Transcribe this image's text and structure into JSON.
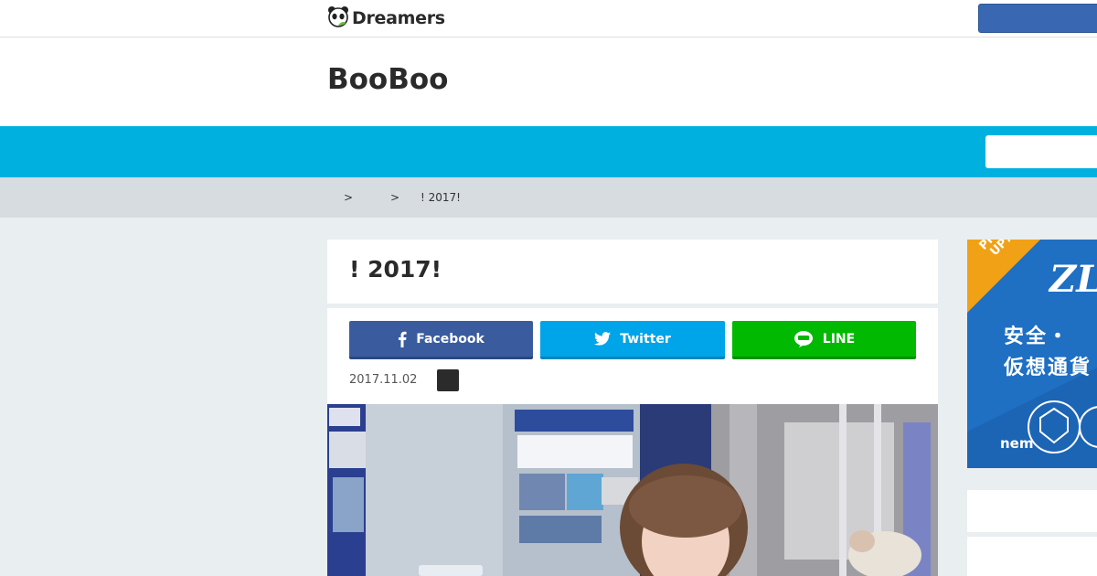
{
  "topbar": {
    "logo_text": "Dreamers"
  },
  "site": {
    "title": "BooBoo"
  },
  "breadcrumb": {
    "separator_1": ">",
    "separator_2": ">",
    "current": "! 2017!"
  },
  "post": {
    "title": "! 2017!",
    "date": "2017.11.02"
  },
  "share": {
    "facebook_label": "Facebook",
    "twitter_label": "Twitter",
    "line_label": "LINE"
  },
  "sidebar": {
    "ad": {
      "pickup_label_1": "PICK",
      "pickup_label_2": "UP!",
      "headline_1": "安全・",
      "headline_2": "仮想通貨",
      "brand": "nem"
    }
  },
  "colors": {
    "nav_blue": "#00b1e0",
    "facebook": "#3a5c9f",
    "twitter": "#00a4e8",
    "line": "#00b900",
    "breadcrumb_bg": "#d7dce1",
    "main_bg": "#e9eef0"
  }
}
